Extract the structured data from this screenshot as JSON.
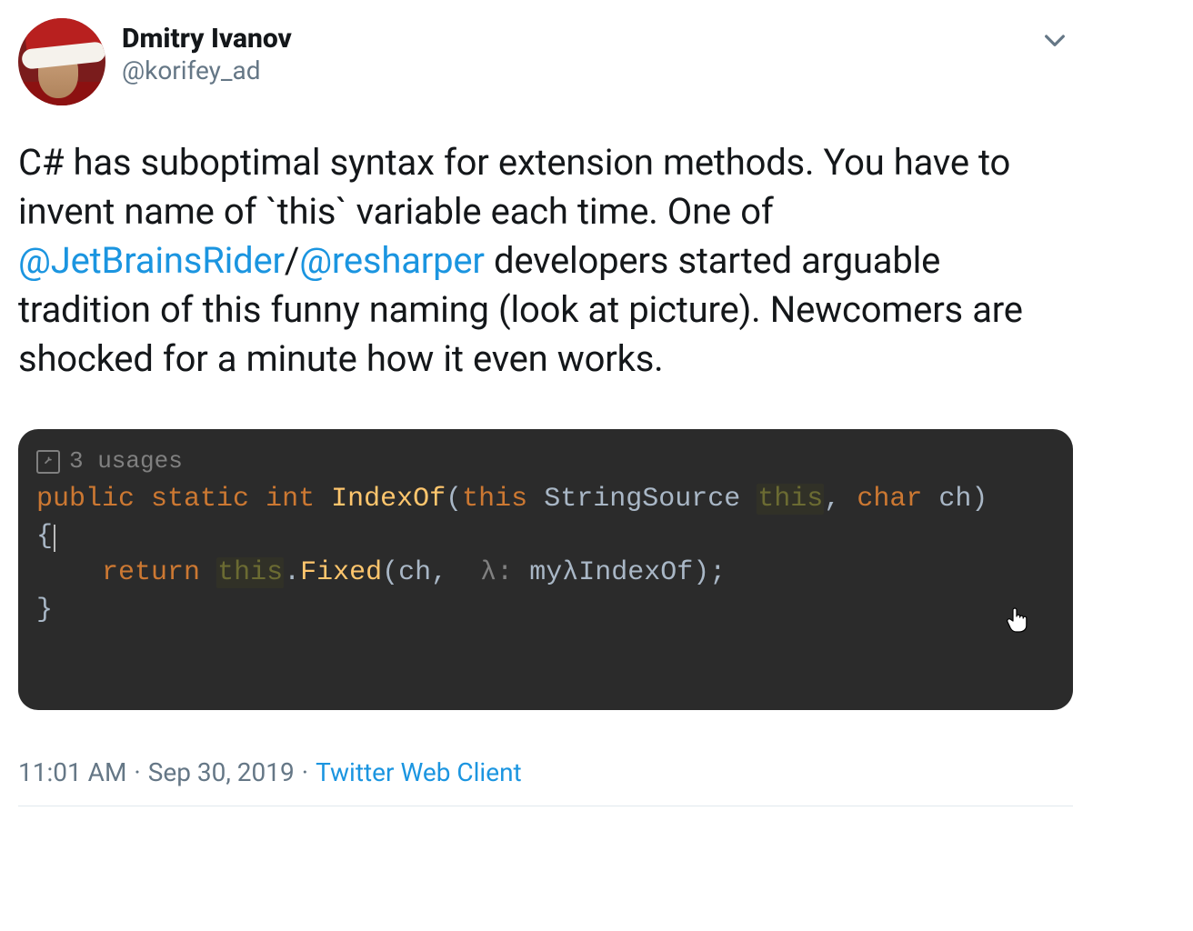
{
  "user": {
    "display_name": "Dmitry Ivanov",
    "handle": "@korifey_ad"
  },
  "tweet": {
    "part1": "C# has suboptimal syntax for extension methods. You have to invent name of `this` variable each time. One of ",
    "mention1": "@JetBrainsRider",
    "slash": "/",
    "mention2": "@resharper",
    "part2": " developers started arguable tradition of this funny naming (look at picture). Newcomers are shocked for a minute how it even works."
  },
  "code": {
    "usages_label": "3 usages",
    "line1": {
      "kw1": "public",
      "kw2": "static",
      "kw3": "int",
      "fn": "IndexOf",
      "open": "(",
      "kw_this": "this",
      "type": "StringSource",
      "id_this": "thіs",
      "comma1": ",",
      "kw_char": "char",
      "id_ch": "ch",
      "close": ")"
    },
    "line2_open": "{",
    "line3": {
      "indent": "    ",
      "kw_return": "return",
      "id_this": "thіs",
      "dot": ".",
      "fn": "Fixed",
      "open": "(",
      "arg1": "ch",
      "comma1": ",",
      "hint": "λ:",
      "arg2": "myλIndexOf",
      "close": ");"
    },
    "line4_close": "}"
  },
  "meta": {
    "time": "11:01 AM",
    "date": "Sep 30, 2019",
    "client": "Twitter Web Client"
  }
}
